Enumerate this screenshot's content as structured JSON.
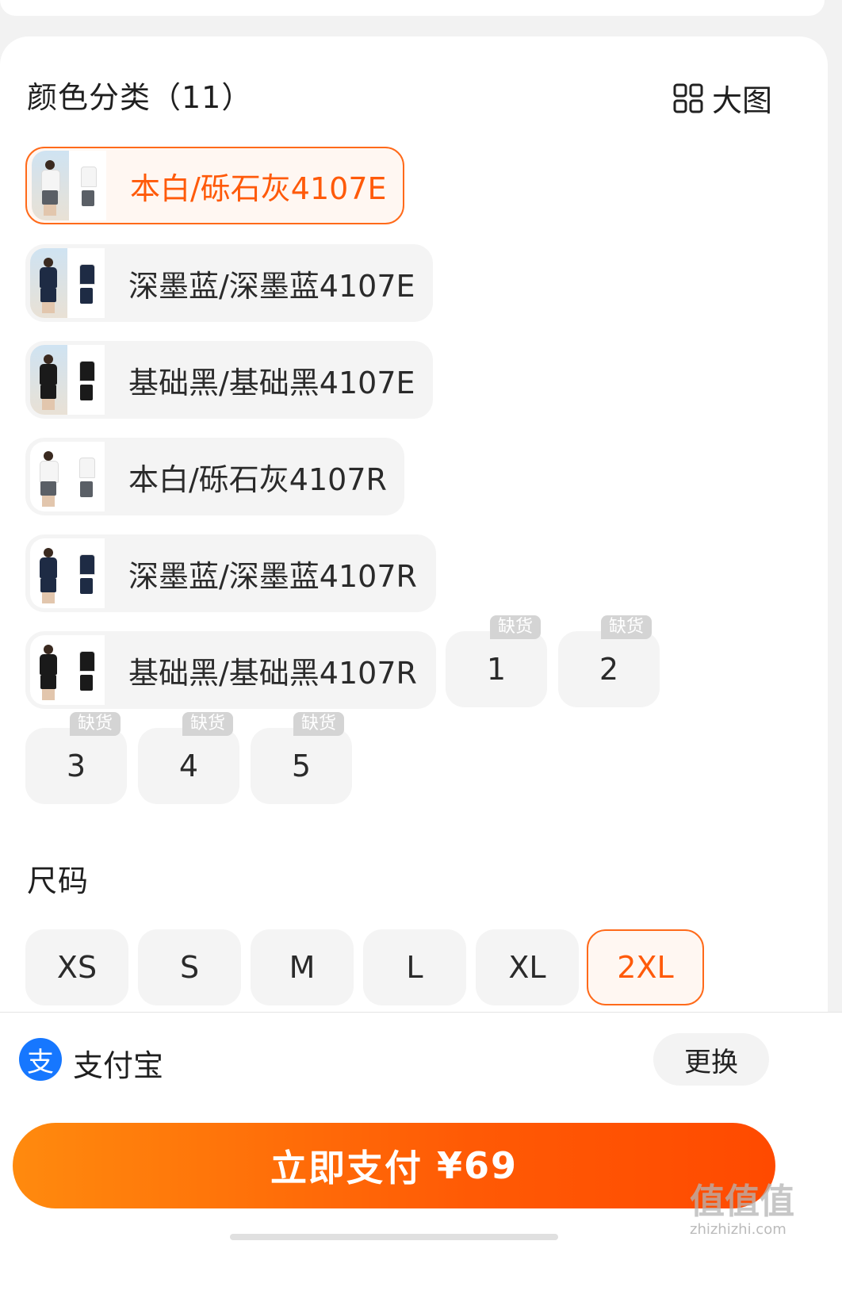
{
  "color_section": {
    "title": "颜色分类（11）",
    "big_view_label": "大图",
    "options": [
      {
        "label": "本白/砾石灰4107E",
        "selected": true,
        "shirt": "#f5f5f5",
        "pants": "#5a5f66"
      },
      {
        "label": "深墨蓝/深墨蓝4107E",
        "selected": false,
        "shirt": "#1e2b44",
        "pants": "#1e2b44"
      },
      {
        "label": "基础黑/基础黑4107E",
        "selected": false,
        "shirt": "#1a1a1a",
        "pants": "#1a1a1a"
      },
      {
        "label": "本白/砾石灰4107R",
        "selected": false,
        "shirt": "#f5f5f5",
        "pants": "#5a5f66"
      },
      {
        "label": "深墨蓝/深墨蓝4107R",
        "selected": false,
        "shirt": "#1e2b44",
        "pants": "#1e2b44"
      },
      {
        "label": "基础黑/基础黑4107R",
        "selected": false,
        "shirt": "#1a1a1a",
        "pants": "#1a1a1a"
      }
    ],
    "numbered_options": [
      {
        "label": "1",
        "badge": "缺货"
      },
      {
        "label": "2",
        "badge": "缺货"
      },
      {
        "label": "3",
        "badge": "缺货"
      },
      {
        "label": "4",
        "badge": "缺货"
      },
      {
        "label": "5",
        "badge": "缺货"
      }
    ]
  },
  "size_section": {
    "title": "尺码",
    "sizes": [
      {
        "label": "XS",
        "selected": false
      },
      {
        "label": "S",
        "selected": false
      },
      {
        "label": "M",
        "selected": false
      },
      {
        "label": "L",
        "selected": false
      },
      {
        "label": "XL",
        "selected": false
      },
      {
        "label": "2XL",
        "selected": true
      }
    ]
  },
  "payment": {
    "icon_glyph": "支",
    "method_label": "支付宝",
    "change_label": "更换"
  },
  "pay_button": {
    "label": "立即支付",
    "price": "¥69"
  },
  "watermark": {
    "text": "值值值",
    "domain": "zhizhizhi.com"
  },
  "colors": {
    "accent": "#ff5a0a",
    "chip_bg": "#f4f4f4",
    "alipay_blue": "#1677ff"
  }
}
